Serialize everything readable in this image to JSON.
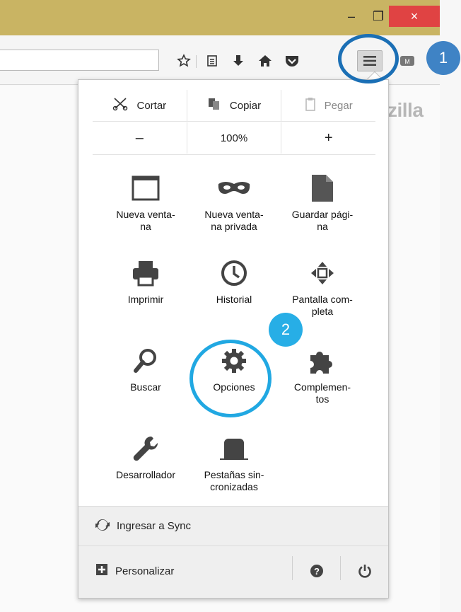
{
  "window": {
    "minimize_label": "–",
    "maximize_label": "❐",
    "close_label": "×"
  },
  "toolbar": {
    "icons": [
      "star-icon",
      "reading-list-icon",
      "download-icon",
      "home-icon",
      "pocket-icon",
      "hamburger-menu-icon",
      "addon-icon"
    ]
  },
  "background": {
    "brand_fragment": "zilla"
  },
  "menu": {
    "edit": {
      "cut": "Cortar",
      "copy": "Copiar",
      "paste": "Pegar"
    },
    "zoom": {
      "out": "–",
      "level": "100%",
      "in": "+"
    },
    "items": [
      {
        "label": "Nueva venta-\nna",
        "icon": "new-window-icon"
      },
      {
        "label": "Nueva venta-\nna privada",
        "icon": "private-mask-icon"
      },
      {
        "label": "Guardar pági-\nna",
        "icon": "save-page-icon"
      },
      {
        "label": "Imprimir",
        "icon": "print-icon"
      },
      {
        "label": "Historial",
        "icon": "history-clock-icon"
      },
      {
        "label": "Pantalla com-\npleta",
        "icon": "fullscreen-icon"
      },
      {
        "label": "Buscar",
        "icon": "search-icon"
      },
      {
        "label": "Opciones",
        "icon": "gear-icon"
      },
      {
        "label": "Complemen-\ntos",
        "icon": "puzzle-icon"
      },
      {
        "label": "Desarrollador",
        "icon": "wrench-icon"
      },
      {
        "label": "Pestañas sin-\ncronizadas",
        "icon": "synced-tabs-icon"
      }
    ],
    "sync_label": "Ingresar a Sync",
    "customize_label": "Personalizar"
  },
  "annotations": {
    "step1": "1",
    "step2": "2",
    "color": "#1e90c8"
  }
}
